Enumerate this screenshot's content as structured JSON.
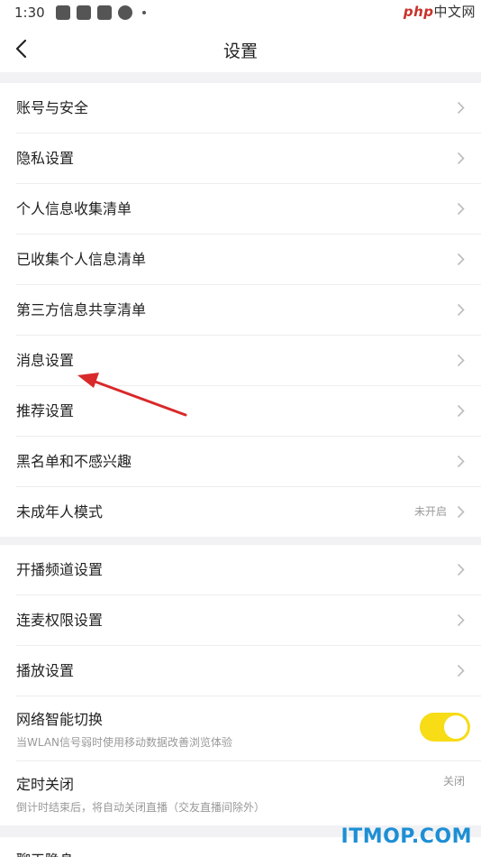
{
  "status_bar": {
    "time": "1:30"
  },
  "watermark_top": {
    "brand": "php",
    "site": "中文网"
  },
  "header": {
    "title": "设置"
  },
  "group1": [
    {
      "label": "账号与安全"
    },
    {
      "label": "隐私设置"
    },
    {
      "label": "个人信息收集清单"
    },
    {
      "label": "已收集个人信息清单"
    },
    {
      "label": "第三方信息共享清单"
    },
    {
      "label": "消息设置"
    },
    {
      "label": "推荐设置"
    },
    {
      "label": "黑名单和不感兴趣"
    },
    {
      "label": "未成年人模式",
      "value": "未开启"
    }
  ],
  "group2": [
    {
      "label": "开播频道设置"
    },
    {
      "label": "连麦权限设置"
    },
    {
      "label": "播放设置"
    }
  ],
  "network_switch": {
    "label": "网络智能切换",
    "subtitle": "当WLAN信号弱时使用移动数据改善浏览体验",
    "enabled": true
  },
  "timer": {
    "label": "定时关闭",
    "value": "关闭",
    "subtitle": "倒计时结束后，将自动关闭直播（交友直播间除外）"
  },
  "group3": [
    {
      "label": "聊天隐身"
    }
  ],
  "colors": {
    "accent": "#f7dc16",
    "annotation_arrow": "#d9292a"
  },
  "watermark_bottom": "ITMOP.COM"
}
